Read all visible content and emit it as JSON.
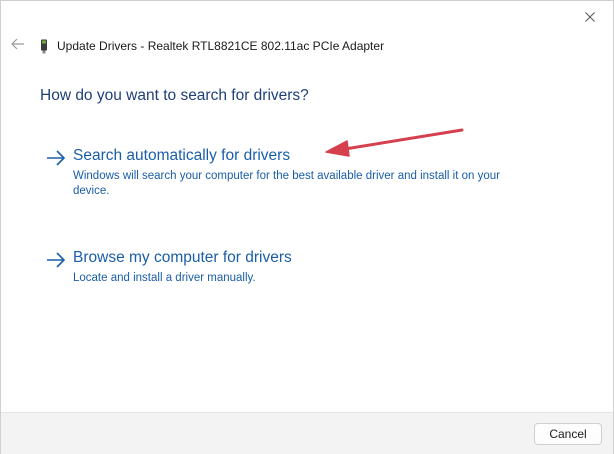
{
  "window": {
    "title": "Update Drivers - Realtek RTL8821CE 802.11ac PCIe Adapter"
  },
  "icons": {
    "close": "close-icon",
    "back": "back-arrow-icon",
    "device": "network-adapter-icon",
    "option_arrow": "right-arrow-icon"
  },
  "main": {
    "question": "How do you want to search for drivers?",
    "options": [
      {
        "title": "Search automatically for drivers",
        "description": "Windows will search your computer for the best available driver and install it on your device."
      },
      {
        "title": "Browse my computer for drivers",
        "description": "Locate and install a driver manually."
      }
    ]
  },
  "footer": {
    "cancel_label": "Cancel"
  },
  "colors": {
    "link": "#1a5ea8",
    "heading": "#1f3f79",
    "annotation": "#d6404e",
    "footer_bg": "#f3f3f3"
  }
}
